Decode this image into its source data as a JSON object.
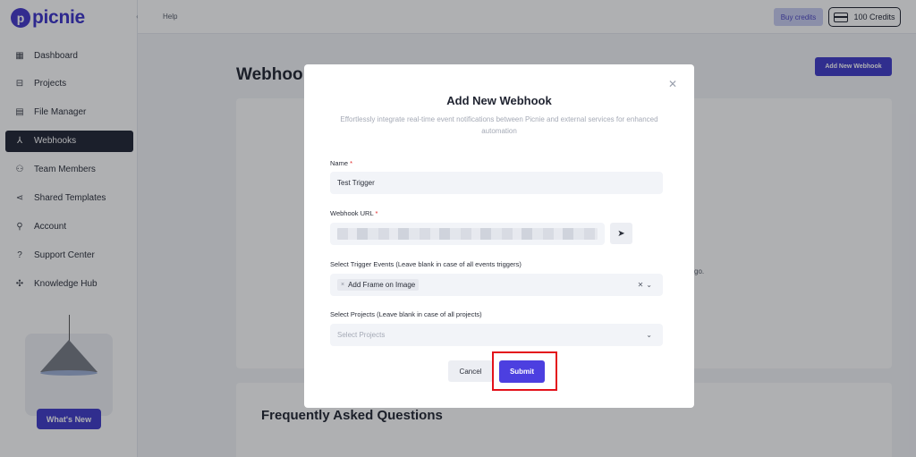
{
  "brand": {
    "logo_text": "picnie",
    "logo_mark": "p"
  },
  "sidebar": {
    "items": [
      {
        "label": "Dashboard",
        "icon": "dashboard-icon",
        "glyph": "▦",
        "active": false
      },
      {
        "label": "Projects",
        "icon": "projects-icon",
        "glyph": "⊟",
        "active": false
      },
      {
        "label": "File Manager",
        "icon": "file-icon",
        "glyph": "▤",
        "active": false
      },
      {
        "label": "Webhooks",
        "icon": "webhook-icon",
        "glyph": "⅄",
        "active": true
      },
      {
        "label": "Team Members",
        "icon": "team-icon",
        "glyph": "⚇",
        "active": false
      },
      {
        "label": "Shared Templates",
        "icon": "share-icon",
        "glyph": "⋖",
        "active": false
      },
      {
        "label": "Account",
        "icon": "account-icon",
        "glyph": "⚲",
        "active": false
      },
      {
        "label": "Support Center",
        "icon": "help-icon",
        "glyph": "?",
        "active": false
      },
      {
        "label": "Knowledge Hub",
        "icon": "knowledge-icon",
        "glyph": "✣",
        "active": false
      }
    ],
    "whats_new": "What's New"
  },
  "topbar": {
    "help": "Help",
    "buy_credits": "Buy credits",
    "credits": "100 Credits"
  },
  "main": {
    "title": "Webhoo",
    "add_button": "Add New Webhook",
    "partial_text": "go.",
    "faq_title": "Frequently Asked Questions"
  },
  "modal": {
    "title": "Add New Webhook",
    "subtitle": "Effortlessly integrate real-time event notifications between Picnie and external services for enhanced automation",
    "name_label": "Name",
    "name_value": "Test Trigger",
    "url_label": "Webhook URL",
    "events_label": "Select Trigger Events (Leave blank in case of all events triggers)",
    "events_chip": "Add Frame on Image",
    "projects_label": "Select Projects (Leave blank in case of all projects)",
    "projects_placeholder": "Select Projects",
    "cancel": "Cancel",
    "submit": "Submit",
    "required_mark": "*"
  },
  "colors": {
    "accent": "#3f3ac9",
    "highlight": "#e3121b",
    "active_nav": "#1f2333"
  }
}
